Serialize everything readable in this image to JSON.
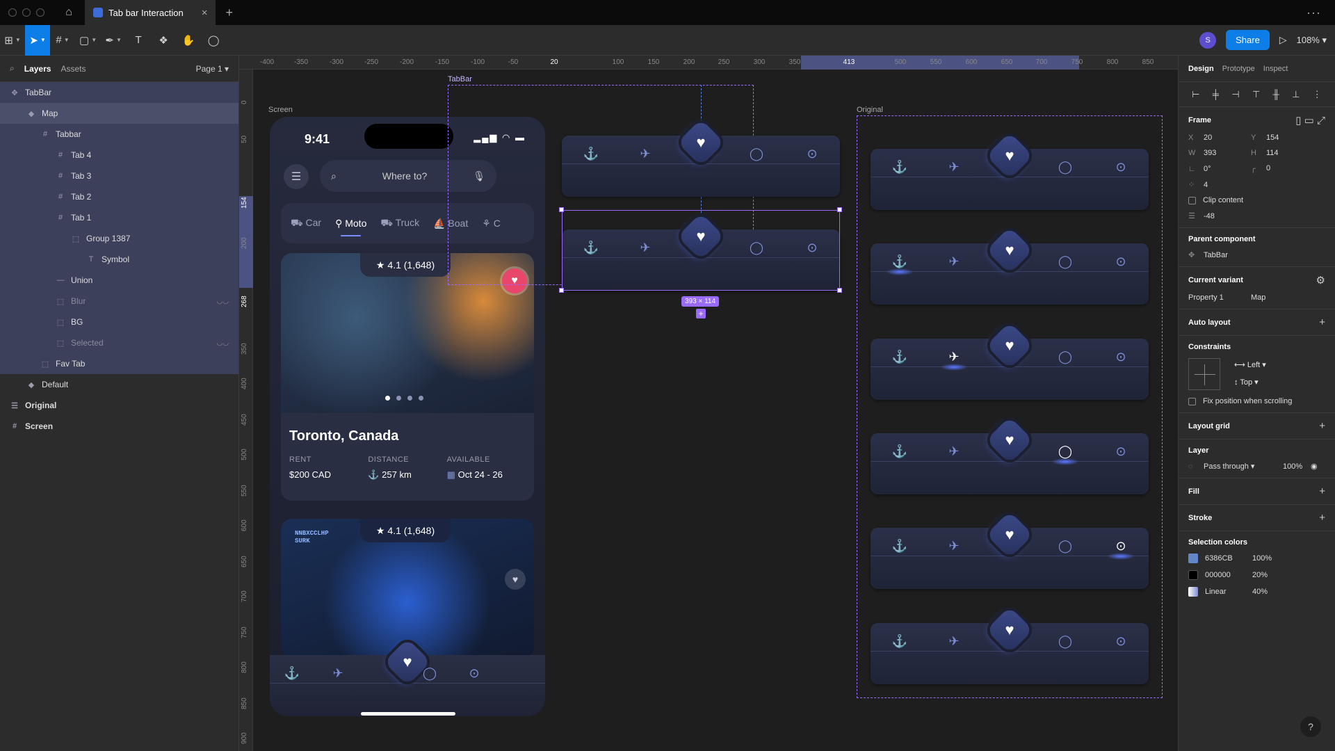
{
  "titlebar": {
    "tab_title": "Tab bar Interaction",
    "close": "×",
    "new_tab": "+",
    "more": "···"
  },
  "toolbar": {
    "avatar": "S",
    "share": "Share",
    "play": "▷",
    "zoom": "108%"
  },
  "left_panel": {
    "layers_tab": "Layers",
    "assets_tab": "Assets",
    "page": "Page 1",
    "items": [
      {
        "label": "TabBar"
      },
      {
        "label": "Map"
      },
      {
        "label": "Tabbar"
      },
      {
        "label": "Tab 4"
      },
      {
        "label": "Tab 3"
      },
      {
        "label": "Tab 2"
      },
      {
        "label": "Tab 1"
      },
      {
        "label": "Group 1387"
      },
      {
        "label": "Symbol"
      },
      {
        "label": "Union"
      },
      {
        "label": "Blur"
      },
      {
        "label": "BG"
      },
      {
        "label": "Selected"
      },
      {
        "label": "Fav Tab"
      },
      {
        "label": "Default"
      },
      {
        "label": "Original"
      },
      {
        "label": "Screen"
      }
    ]
  },
  "rulers": {
    "top": [
      "-400",
      "-350",
      "-300",
      "-250",
      "-200",
      "-150",
      "-100",
      "-50",
      "20",
      "100",
      "150",
      "200",
      "250",
      "300",
      "350",
      "413",
      "500",
      "550",
      "600",
      "650",
      "700",
      "750",
      "800",
      "850"
    ],
    "left": [
      "0",
      "50",
      "154",
      "200",
      "268",
      "350",
      "400",
      "450",
      "500",
      "550",
      "600",
      "650",
      "700",
      "750",
      "800",
      "850",
      "900"
    ]
  },
  "canvas": {
    "screen_label": "Screen",
    "tabbar_label": "TabBar",
    "original_label": "Original",
    "size_badge": "393 × 114",
    "add_badge": "+"
  },
  "phone": {
    "time": "9:41",
    "signal": "▂▄▆ ◠ ▬",
    "search_placeholder": "Where to?",
    "categories": [
      "Car",
      "Moto",
      "Truck",
      "Boat",
      "C"
    ],
    "card1": {
      "rating": "4.1 (1,648)",
      "title": "Toronto, Canada",
      "rent_label": "RENT",
      "rent": "$200 CAD",
      "distance_label": "DISTANCE",
      "distance": "257 km",
      "available_label": "AVAILABLE",
      "available": "Oct 24 - 26"
    },
    "card2": {
      "rating": "4.1 (1,648)",
      "hud": "NNBXCCLHP\nSURK"
    }
  },
  "right_panel": {
    "tabs": [
      "Design",
      "Prototype",
      "Inspect"
    ],
    "frame": {
      "title": "Frame",
      "x": "20",
      "y": "154",
      "w": "393",
      "h": "114",
      "rotation": "0°",
      "radius": "0",
      "spacing": "4",
      "clip": "Clip content",
      "gap": "-48"
    },
    "parent": {
      "title": "Parent component",
      "name": "TabBar"
    },
    "variant": {
      "title": "Current variant",
      "prop": "Property 1",
      "value": "Map"
    },
    "auto_layout": "Auto layout",
    "constraints": {
      "title": "Constraints",
      "h": "Left",
      "v": "Top",
      "fix": "Fix position when scrolling"
    },
    "layout_grid": "Layout grid",
    "layer": {
      "title": "Layer",
      "mode": "Pass through",
      "opacity": "100%"
    },
    "fill": "Fill",
    "stroke": "Stroke",
    "selection_colors": {
      "title": "Selection colors",
      "items": [
        {
          "name": "6386CB",
          "pct": "100%",
          "color": "#6386CB"
        },
        {
          "name": "000000",
          "pct": "20%",
          "color": "#000000"
        },
        {
          "name": "Linear",
          "pct": "40%",
          "color": "#7f8ad0"
        }
      ]
    },
    "help": "?"
  },
  "colors": {
    "accent": "#0d7ee8",
    "selection": "#9b6bff",
    "icon": "#7d8fd6"
  }
}
